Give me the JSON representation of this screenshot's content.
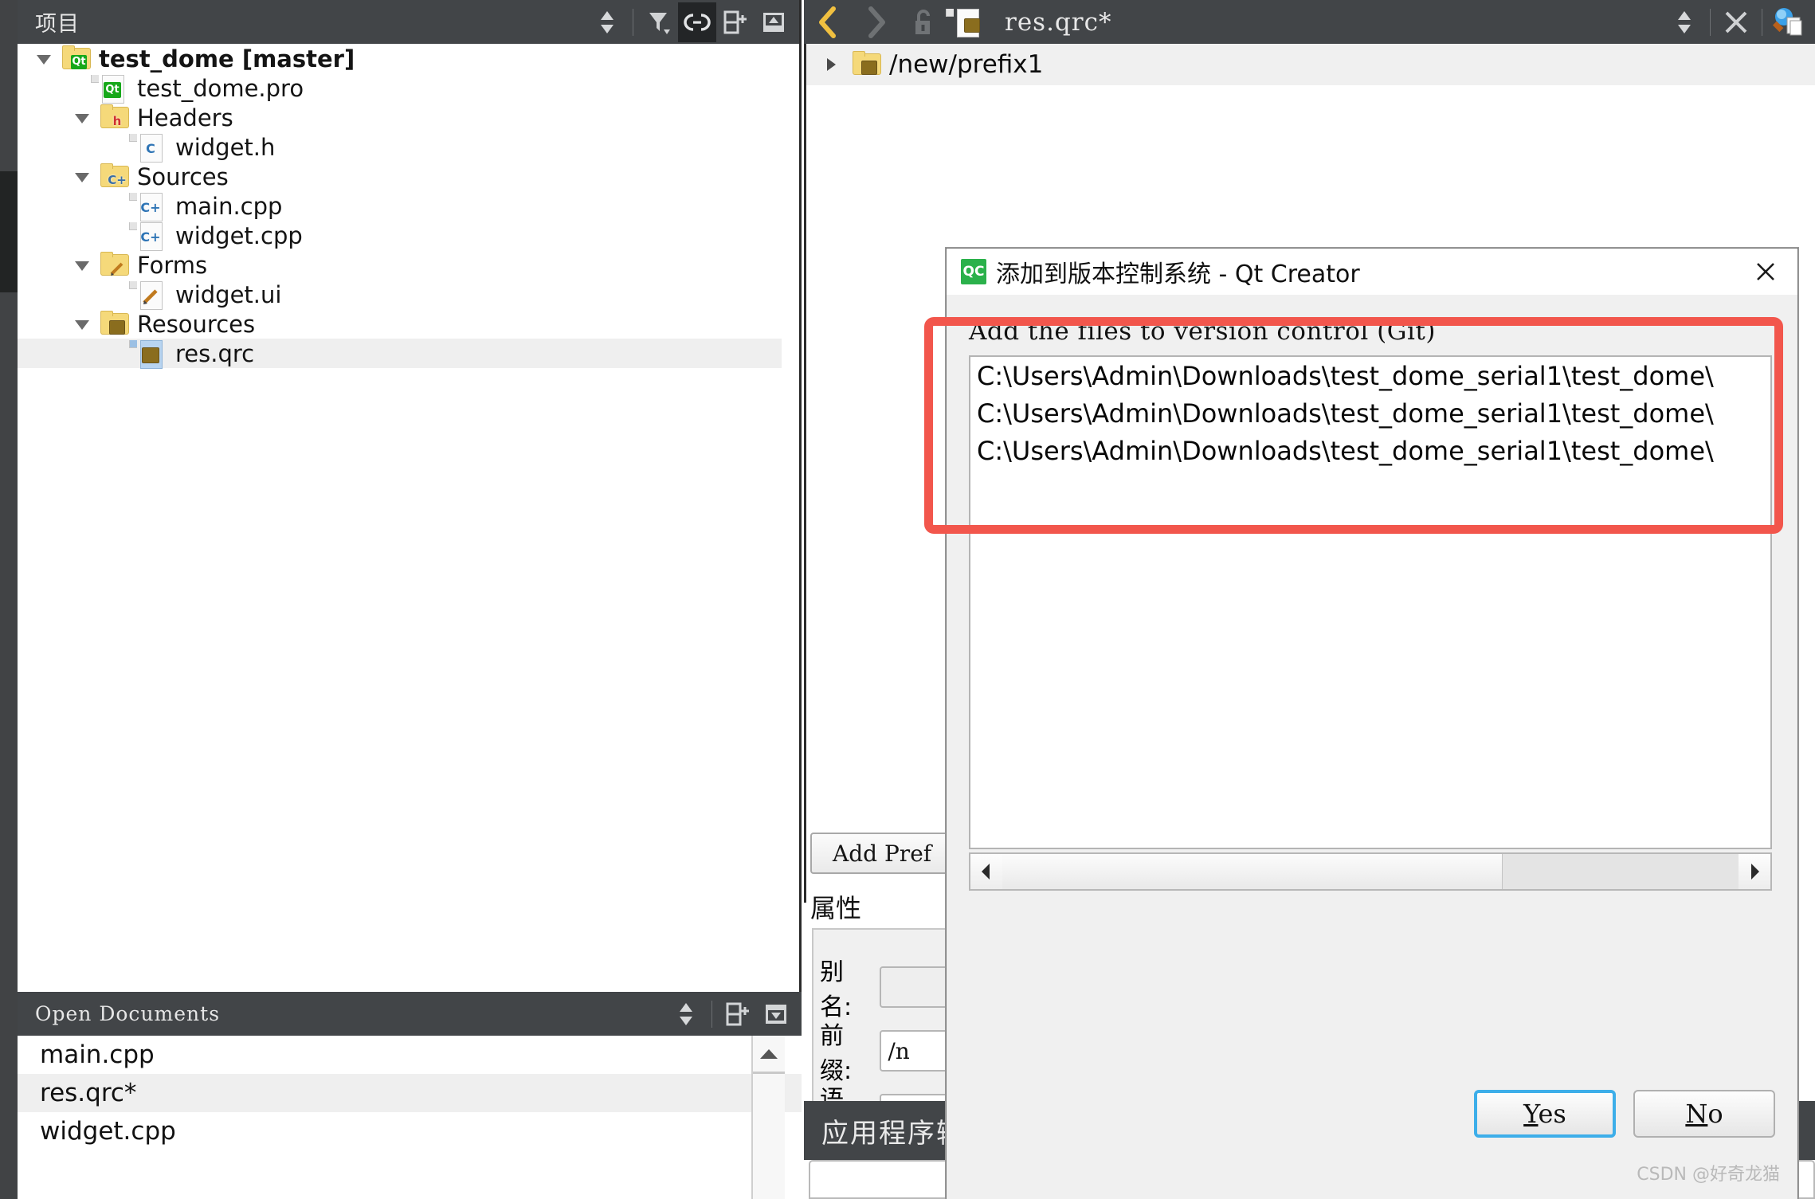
{
  "left_dock": {
    "title": "项目",
    "toolbar": [
      {
        "name": "synchronize-icon",
        "label": "Synchronize"
      },
      {
        "name": "filter-icon",
        "label": "Filter Tree"
      },
      {
        "name": "link-icon",
        "label": "Synchronize with Editor",
        "active": true
      },
      {
        "name": "split-add-icon",
        "label": "Add Split"
      },
      {
        "name": "close-split-icon",
        "label": "Close Split"
      }
    ],
    "tree": [
      {
        "label": "test_dome [master]",
        "depth": 0,
        "expanded": true,
        "icon": "folder-qt-icon",
        "bold": true,
        "selected": false
      },
      {
        "label": "test_dome.pro",
        "depth": 1,
        "expanded": null,
        "icon": "file-qt-icon",
        "bold": false,
        "selected": false
      },
      {
        "label": "Headers",
        "depth": 1,
        "expanded": true,
        "icon": "folder-h-icon",
        "bold": false,
        "selected": false
      },
      {
        "label": "widget.h",
        "depth": 2,
        "expanded": null,
        "icon": "file-c-icon",
        "bold": false,
        "selected": false
      },
      {
        "label": "Sources",
        "depth": 1,
        "expanded": true,
        "icon": "folder-cpp-icon",
        "bold": false,
        "selected": false
      },
      {
        "label": "main.cpp",
        "depth": 2,
        "expanded": null,
        "icon": "file-cpp-icon",
        "bold": false,
        "selected": false
      },
      {
        "label": "widget.cpp",
        "depth": 2,
        "expanded": null,
        "icon": "file-cpp-icon",
        "bold": false,
        "selected": false
      },
      {
        "label": "Forms",
        "depth": 1,
        "expanded": true,
        "icon": "folder-form-icon",
        "bold": false,
        "selected": false
      },
      {
        "label": "widget.ui",
        "depth": 2,
        "expanded": null,
        "icon": "file-ui-icon",
        "bold": false,
        "selected": false
      },
      {
        "label": "Resources",
        "depth": 1,
        "expanded": true,
        "icon": "folder-qrc-icon",
        "bold": false,
        "selected": false
      },
      {
        "label": "res.qrc",
        "depth": 2,
        "expanded": null,
        "icon": "file-qrc-icon",
        "bold": false,
        "selected": true
      }
    ]
  },
  "open_documents": {
    "title": "Open Documents",
    "toolbar": [
      {
        "name": "synchronize-icon",
        "label": "Synchronize"
      },
      {
        "name": "split-add-icon",
        "label": "Add Split"
      },
      {
        "name": "close-split-icon",
        "label": "Close Split"
      }
    ],
    "items": [
      {
        "label": "main.cpp",
        "selected": false
      },
      {
        "label": "res.qrc*",
        "selected": true
      },
      {
        "label": "widget.cpp",
        "selected": false
      }
    ]
  },
  "editor": {
    "toolbar": {
      "back_label": "Go Back",
      "forward_label": "Go Forward",
      "lock_label": "Make Writable",
      "filename": "res.qrc*",
      "split_label": "Split",
      "close_label": "Close Document",
      "find_label": "Find Usages"
    },
    "resource_tree": [
      {
        "label": "/new/prefix1",
        "expanded": false,
        "icon": "folder-qrc-icon"
      }
    ],
    "add_prefix_button": "Add Pref",
    "properties_title": "属性",
    "properties": [
      {
        "label": "别名:",
        "value": "",
        "dim": true
      },
      {
        "label": "前缀:",
        "value": "/n",
        "dim": false
      },
      {
        "label": "语言:",
        "value": "",
        "dim": false
      }
    ],
    "app_output_title": "应用程序输"
  },
  "dialog": {
    "qc_badge": "QC",
    "title": "添加到版本控制系统 - Qt Creator",
    "close_label": "✕",
    "message": "Add the files to version control (Git)",
    "files": [
      "C:\\Users\\Admin\\Downloads\\test_dome_serial1\\test_dome\\",
      "C:\\Users\\Admin\\Downloads\\test_dome_serial1\\test_dome\\",
      "C:\\Users\\Admin\\Downloads\\test_dome_serial1\\test_dome\\"
    ],
    "buttons": [
      {
        "label": "Yes",
        "mnemonic": "Y",
        "primary": true
      },
      {
        "label": "No",
        "mnemonic": "N",
        "primary": false
      }
    ],
    "scrollbar": {
      "left_arrow": "◀",
      "right_arrow": "▶",
      "thumb_fraction": 0.68
    }
  },
  "annotation": {
    "type": "rectangle",
    "color": "#f2564c"
  },
  "watermark": "CSDN @好奇龙猫",
  "colors": {
    "dock_header_bg": "#424548",
    "rail_bg": "#414345",
    "selection_bg": "#efefef",
    "accent_blue": "#3daee9",
    "annotation_red": "#f2564c",
    "qt_green": "#2bb14b"
  }
}
